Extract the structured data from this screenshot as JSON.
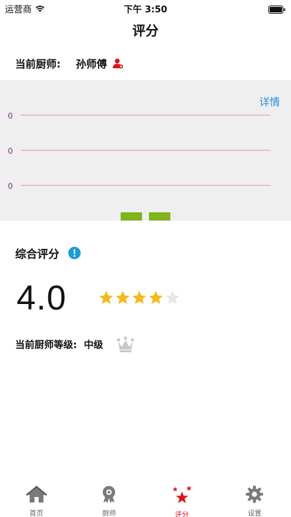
{
  "status": {
    "carrier": "运营商",
    "time": "下午 3:50"
  },
  "nav": {
    "title": "评分"
  },
  "chef": {
    "label": "当前厨师:",
    "name": "孙师傅"
  },
  "chart": {
    "details_label": "详情"
  },
  "chart_data": {
    "type": "bar",
    "categories": [
      "",
      ""
    ],
    "values": [
      0,
      0
    ],
    "y_tick_labels": [
      "0",
      "0",
      "0"
    ],
    "grid": true,
    "colors": {
      "bar": "#7fb31c",
      "grid": "#f08b8b",
      "tick": "#7a1f86",
      "background": "#efefef"
    }
  },
  "rating": {
    "title": "综合评分",
    "score": "4.0",
    "stars_filled": 4,
    "stars_total": 5,
    "star_color": "#f6b81c",
    "star_empty_color": "#e6e6e6"
  },
  "level": {
    "label": "当前厨师等级:",
    "value": "中级"
  },
  "tabs": [
    {
      "label": "首页",
      "icon": "home-icon",
      "active": false
    },
    {
      "label": "厨师",
      "icon": "chef-badge-icon",
      "active": false
    },
    {
      "label": "评分",
      "icon": "stars-icon",
      "active": true
    },
    {
      "label": "设置",
      "icon": "gear-icon",
      "active": false
    }
  ],
  "colors": {
    "accent": "#d8151a",
    "link": "#2b8ee0",
    "info": "#1e9bd7"
  }
}
